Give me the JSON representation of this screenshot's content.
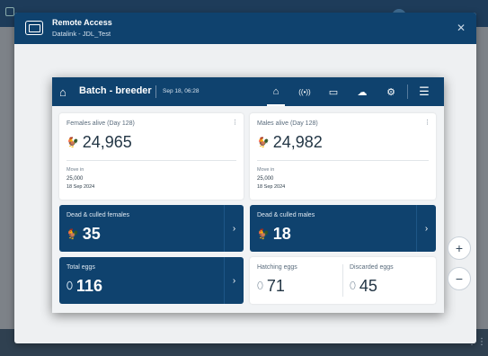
{
  "dialog": {
    "title": "Remote Access",
    "subtitle": "Datalink - JDL_Test",
    "close_icon": "close-icon"
  },
  "app": {
    "title": "Batch - breeder",
    "date": "Sep 18, 06:28",
    "nav": [
      {
        "name": "batch-icon",
        "glyph": "⌂"
      },
      {
        "name": "signal-icon",
        "glyph": "((•))"
      },
      {
        "name": "screen-icon",
        "glyph": "▭"
      },
      {
        "name": "cloud-icon",
        "glyph": "☁"
      },
      {
        "name": "gear-icon",
        "glyph": "⚙"
      },
      {
        "name": "menu-icon",
        "glyph": "☰"
      }
    ]
  },
  "cards": {
    "females": {
      "label": "Females alive (Day 128)",
      "value": "24,965",
      "move_in_label": "Move in",
      "move_in_value": "25,000",
      "move_in_date": "18 Sep 2024"
    },
    "males": {
      "label": "Males alive (Day 128)",
      "value": "24,982",
      "move_in_label": "Move in",
      "move_in_value": "25,000",
      "move_in_date": "18 Sep 2024"
    },
    "dead_females": {
      "label": "Dead & culled females",
      "value": "35"
    },
    "dead_males": {
      "label": "Dead & culled males",
      "value": "18"
    },
    "total_eggs": {
      "label": "Total eggs",
      "value": "116"
    },
    "hatching_eggs": {
      "label": "Hatching eggs",
      "value": "71"
    },
    "discarded_eggs": {
      "label": "Discarded eggs",
      "value": "45"
    }
  },
  "zoom": {
    "in": "+",
    "out": "−"
  }
}
